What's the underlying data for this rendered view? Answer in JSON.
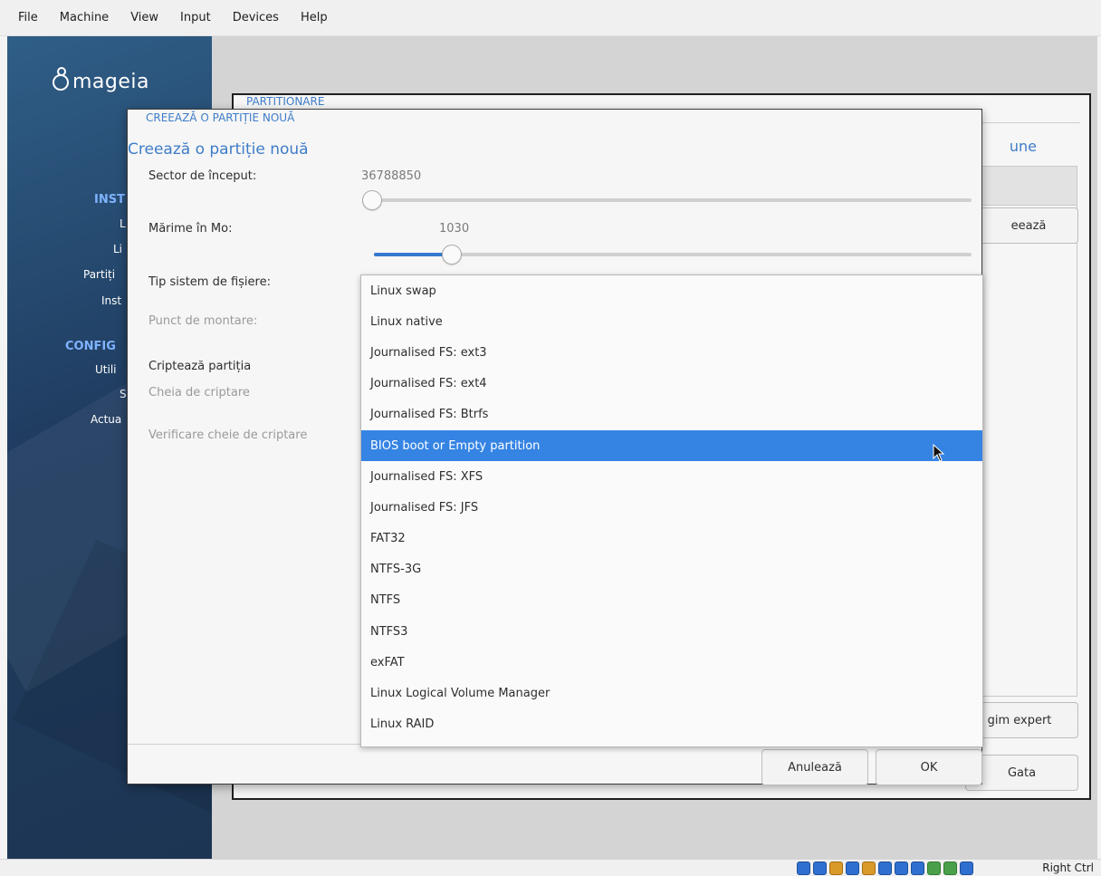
{
  "menubar": {
    "items": [
      "File",
      "Machine",
      "View",
      "Input",
      "Devices",
      "Help"
    ]
  },
  "sidebar": {
    "logo_text": "mageia",
    "items": [
      {
        "label": "INST",
        "heading": true
      },
      {
        "label": "L"
      },
      {
        "label": "Li"
      },
      {
        "label": "Partiți"
      },
      {
        "label": "Inst"
      },
      {
        "label": "CONFIG",
        "heading": true
      },
      {
        "label": "Utili"
      },
      {
        "label": "S"
      },
      {
        "label": "Actua"
      }
    ]
  },
  "background_window": {
    "title": "PARTITIONARE",
    "heading_right": "une",
    "create_button": "eează",
    "expert_button": "gim expert",
    "done_button": "Gata"
  },
  "dialog": {
    "title": "CREEAZĂ O PARTIȚIE NOUĂ",
    "heading": "Creează o partiție nouă",
    "start_sector_label": "Sector de început:",
    "start_sector_value": "36788850",
    "start_sector_fraction": 0.0,
    "size_label": "Mărime în Mo:",
    "size_value": "1030",
    "size_fraction": 0.13,
    "fs_type_label": "Tip sistem de fișiere:",
    "mount_point_label": "Punct de montare:",
    "encrypt_label": "Criptează partiția",
    "encrypt_key_label": "Cheia de criptare",
    "encrypt_key_verify_label": "Verificare cheie de criptare",
    "cancel_button": "Anulează",
    "ok_button": "OK"
  },
  "fs_dropdown": {
    "selected_index": 5,
    "options": [
      "Linux swap",
      "Linux native",
      "Journalised FS: ext3",
      "Journalised FS: ext4",
      "Journalised FS: Btrfs",
      "BIOS boot or Empty partition",
      "Journalised FS: XFS",
      "Journalised FS: JFS",
      "FAT32",
      "NTFS-3G",
      "NTFS",
      "NTFS3",
      "exFAT",
      "Linux Logical Volume Manager",
      "Linux RAID"
    ]
  },
  "statusbar": {
    "host_key": "Right Ctrl"
  },
  "colors": {
    "accent": "#3584e4",
    "title_blue": "#3e7cc8",
    "sidebar": "#203d61"
  }
}
